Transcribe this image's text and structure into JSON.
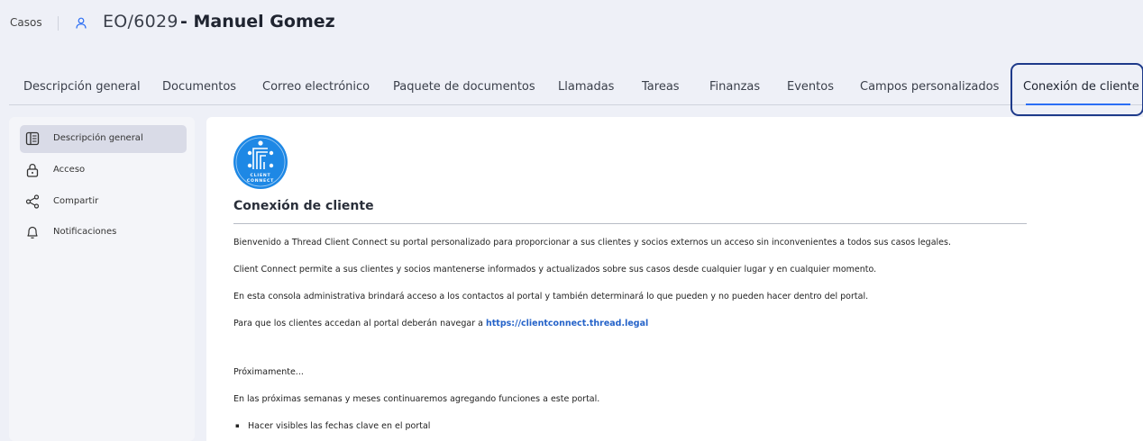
{
  "header": {
    "breadcrumb": "Casos",
    "case_id": "EO/6029",
    "case_name": "- Manuel Gomez"
  },
  "tabs": [
    {
      "label": "Descripción general"
    },
    {
      "label": "Documentos"
    },
    {
      "label": "Correo electrónico"
    },
    {
      "label": "Paquete de documentos"
    },
    {
      "label": "Llamadas"
    },
    {
      "label": "Tareas"
    },
    {
      "label": "Finanzas"
    },
    {
      "label": "Eventos"
    },
    {
      "label": "Campos personalizados"
    },
    {
      "label": "Conexión de cliente",
      "active": true
    }
  ],
  "sidebar": {
    "items": [
      {
        "label": "Descripción general",
        "icon": "overview-icon",
        "active": true
      },
      {
        "label": "Acceso",
        "icon": "lock-icon"
      },
      {
        "label": "Compartir",
        "icon": "share-icon"
      },
      {
        "label": "Notificaciones",
        "icon": "bell-icon"
      }
    ]
  },
  "content": {
    "logo_text": "CLIENT CONNECT",
    "title": "Conexión de cliente",
    "paragraphs": [
      "Bienvenido a Thread Client Connect su portal personalizado para proporcionar a sus clientes y socios externos un acceso sin inconvenientes a todos sus casos legales.",
      "Client Connect permite a sus clientes y socios mantenerse informados y actualizados sobre sus casos desde cualquier lugar y en cualquier momento.",
      "En esta consola administrativa brindará acceso a los contactos al portal y también determinará lo que pueden y no pueden hacer dentro del portal."
    ],
    "portal_prefix": "Para que los clientes accedan al portal deberán navegar a ",
    "portal_link": "https://clientconnect.thread.legal",
    "coming_soon": "Próximamente...",
    "coming_text": "En las próximas semanas y meses continuaremos agregando funciones a este portal.",
    "bullets": [
      "Hacer visibles las fechas clave en el portal"
    ]
  },
  "colors": {
    "accent": "#2a6df4",
    "active_frame": "#1e3a8a",
    "logo_blue": "#1e88e5",
    "link": "#2563c9"
  }
}
